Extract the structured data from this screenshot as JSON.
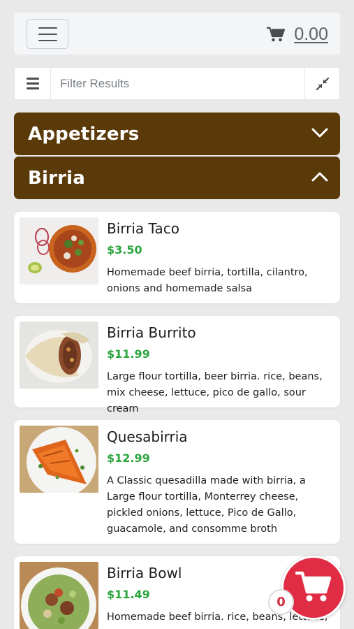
{
  "header": {
    "menu_icon": "hamburger-menu-icon",
    "cart_icon": "shopping-cart-icon",
    "cart_total": "0.00"
  },
  "filter": {
    "list_icon": "list-icon",
    "placeholder": "Filter Results",
    "value": "",
    "collapse_icon": "collapse-arrows-icon"
  },
  "categories": [
    {
      "label": "Appetizers",
      "state": "collapsed",
      "icon": "chevron-down-icon"
    },
    {
      "label": "Birria",
      "state": "expanded",
      "icon": "chevron-up-icon"
    }
  ],
  "items": [
    {
      "name": "Birria Taco",
      "price": "$3.50",
      "description": "Homemade beef birria, tortilla, cilantro, onions and homemade salsa"
    },
    {
      "name": "Birria Burrito",
      "price": "$11.99",
      "description": "Large flour tortilla, beer birria. rice, beans, mix cheese, lettuce, pico de gallo, sour cream"
    },
    {
      "name": "Quesabirria",
      "price": "$12.99",
      "description": "A Classic quesadilla made with birria, a Large flour tortilla, Monterrey cheese, pickled onions, lettuce, Pico de Gallo, guacamole, and consomme broth"
    },
    {
      "name": "Birria Bowl",
      "price": "$11.49",
      "description": "Homemade beef birria. rice, beans, lettuce,"
    }
  ],
  "floating_cart": {
    "icon": "shopping-cart-icon",
    "count": "0"
  },
  "colors": {
    "category_bg": "#5a3a08",
    "price": "#2aa53c",
    "cart_fab": "#e02c44"
  }
}
